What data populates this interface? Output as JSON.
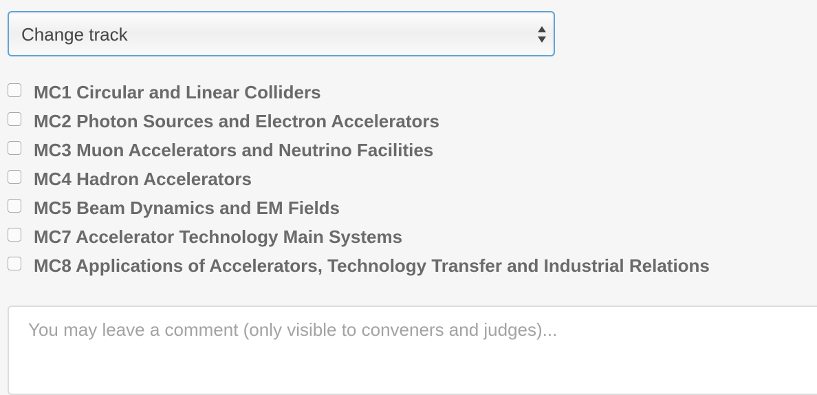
{
  "track_select": {
    "label": "Change track",
    "icon": "up-down-arrows-icon"
  },
  "tracks": [
    {
      "label": "MC1 Circular and Linear Colliders",
      "checked": false
    },
    {
      "label": "MC2 Photon Sources and Electron Accelerators",
      "checked": false
    },
    {
      "label": "MC3 Muon Accelerators and Neutrino Facilities",
      "checked": false
    },
    {
      "label": "MC4 Hadron Accelerators",
      "checked": false
    },
    {
      "label": "MC5 Beam Dynamics and EM Fields",
      "checked": false
    },
    {
      "label": "MC7 Accelerator Technology Main Systems",
      "checked": false
    },
    {
      "label": "MC8 Applications of Accelerators, Technology Transfer and Industrial Relations",
      "checked": false
    }
  ],
  "comment": {
    "value": "",
    "placeholder": "You may leave a comment (only visible to conveners and judges)..."
  },
  "colors": {
    "select_border": "#5fa3d6",
    "label_text": "#6a6a6a",
    "placeholder_text": "#a3a3a3",
    "background": "#f6f6f6"
  }
}
